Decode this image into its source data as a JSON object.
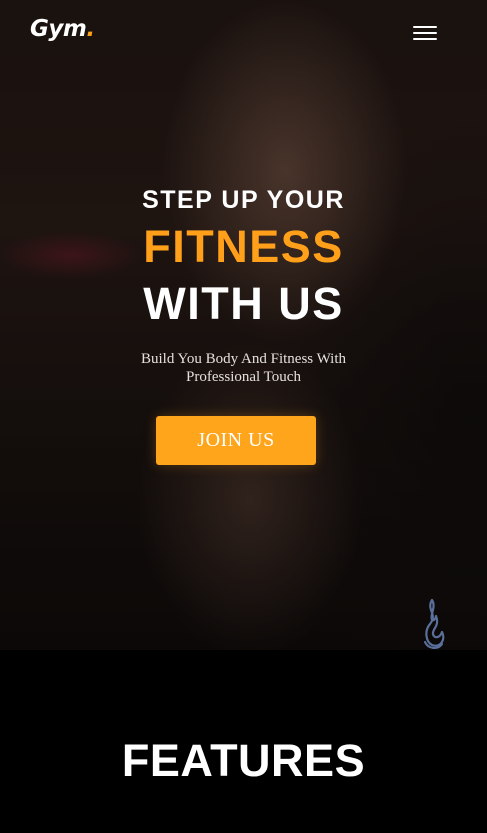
{
  "header": {
    "logo_text": "Gym",
    "logo_dot": ".",
    "menu_icon": "hamburger-menu-icon"
  },
  "hero": {
    "eyebrow": "STEP UP YOUR",
    "headline_accent": "FITNESS",
    "headline_main": "WITH US",
    "subtext": "Build You Body And Fitness With Professional Touch",
    "cta_label": "JOIN US",
    "watermark_icon": "flame-logo-icon"
  },
  "features": {
    "title": "FEATURES"
  },
  "colors": {
    "accent": "#ffa51c",
    "background": "#000000",
    "text": "#ffffff"
  }
}
